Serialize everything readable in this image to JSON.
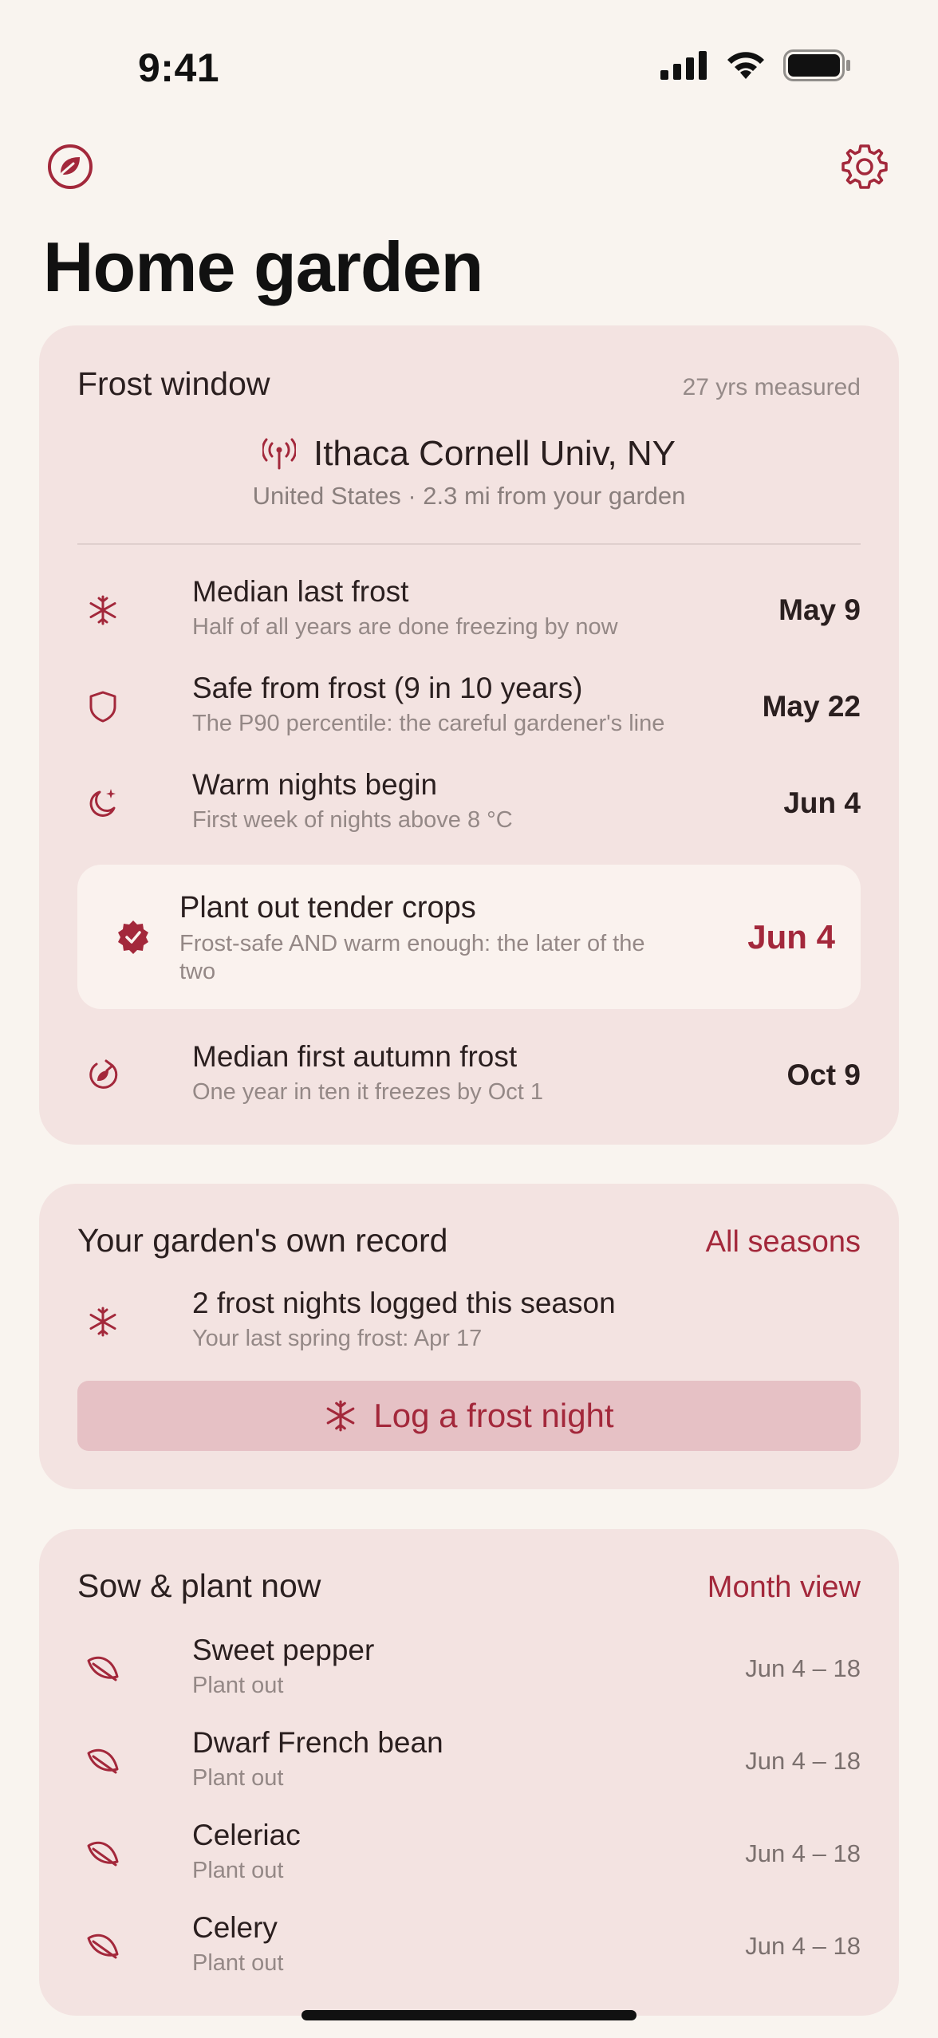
{
  "status_bar": {
    "time": "9:41"
  },
  "header": {
    "title": "Home garden"
  },
  "frost_window": {
    "title": "Frost window",
    "meta": "27 yrs measured",
    "station_name": "Ithaca Cornell Univ, NY",
    "station_sub": "United States · 2.3 mi from your garden",
    "rows": [
      {
        "title": "Median last frost",
        "subtitle": "Half of all years are done freezing by now",
        "value": "May 9",
        "icon": "snowflake-icon"
      },
      {
        "title": "Safe from frost (9 in 10 years)",
        "subtitle": "The P90 percentile: the careful gardener's line",
        "value": "May 22",
        "icon": "shield-icon"
      },
      {
        "title": "Warm nights begin",
        "subtitle": "First week of nights above 8 °C",
        "value": "Jun 4",
        "icon": "moon-stars-icon"
      }
    ],
    "highlight": {
      "title": "Plant out tender crops",
      "subtitle": "Frost-safe AND warm enough: the later of the two",
      "value": "Jun 4",
      "icon": "check-seal-icon"
    },
    "autumn": {
      "title": "Median first autumn frost",
      "subtitle": "One year in ten it freezes by Oct 1",
      "value": "Oct 9",
      "icon": "autumn-cycle-icon"
    }
  },
  "garden_record": {
    "title": "Your garden's own record",
    "link": "All seasons",
    "summary_title": "2 frost nights logged this season",
    "summary_subtitle": "Your last spring frost: Apr 17",
    "button_label": "Log a frost night"
  },
  "sow_plant": {
    "title": "Sow & plant now",
    "link": "Month view",
    "items": [
      {
        "name": "Sweet pepper",
        "action": "Plant out",
        "range": "Jun 4 – 18"
      },
      {
        "name": "Dwarf French bean",
        "action": "Plant out",
        "range": "Jun 4 – 18"
      },
      {
        "name": "Celeriac",
        "action": "Plant out",
        "range": "Jun 4 – 18"
      },
      {
        "name": "Celery",
        "action": "Plant out",
        "range": "Jun 4 – 18"
      }
    ]
  },
  "colors": {
    "accent": "#a3283b",
    "background": "#f9f4ef",
    "card": "#f3e3e1",
    "button": "#e6c1c5"
  }
}
